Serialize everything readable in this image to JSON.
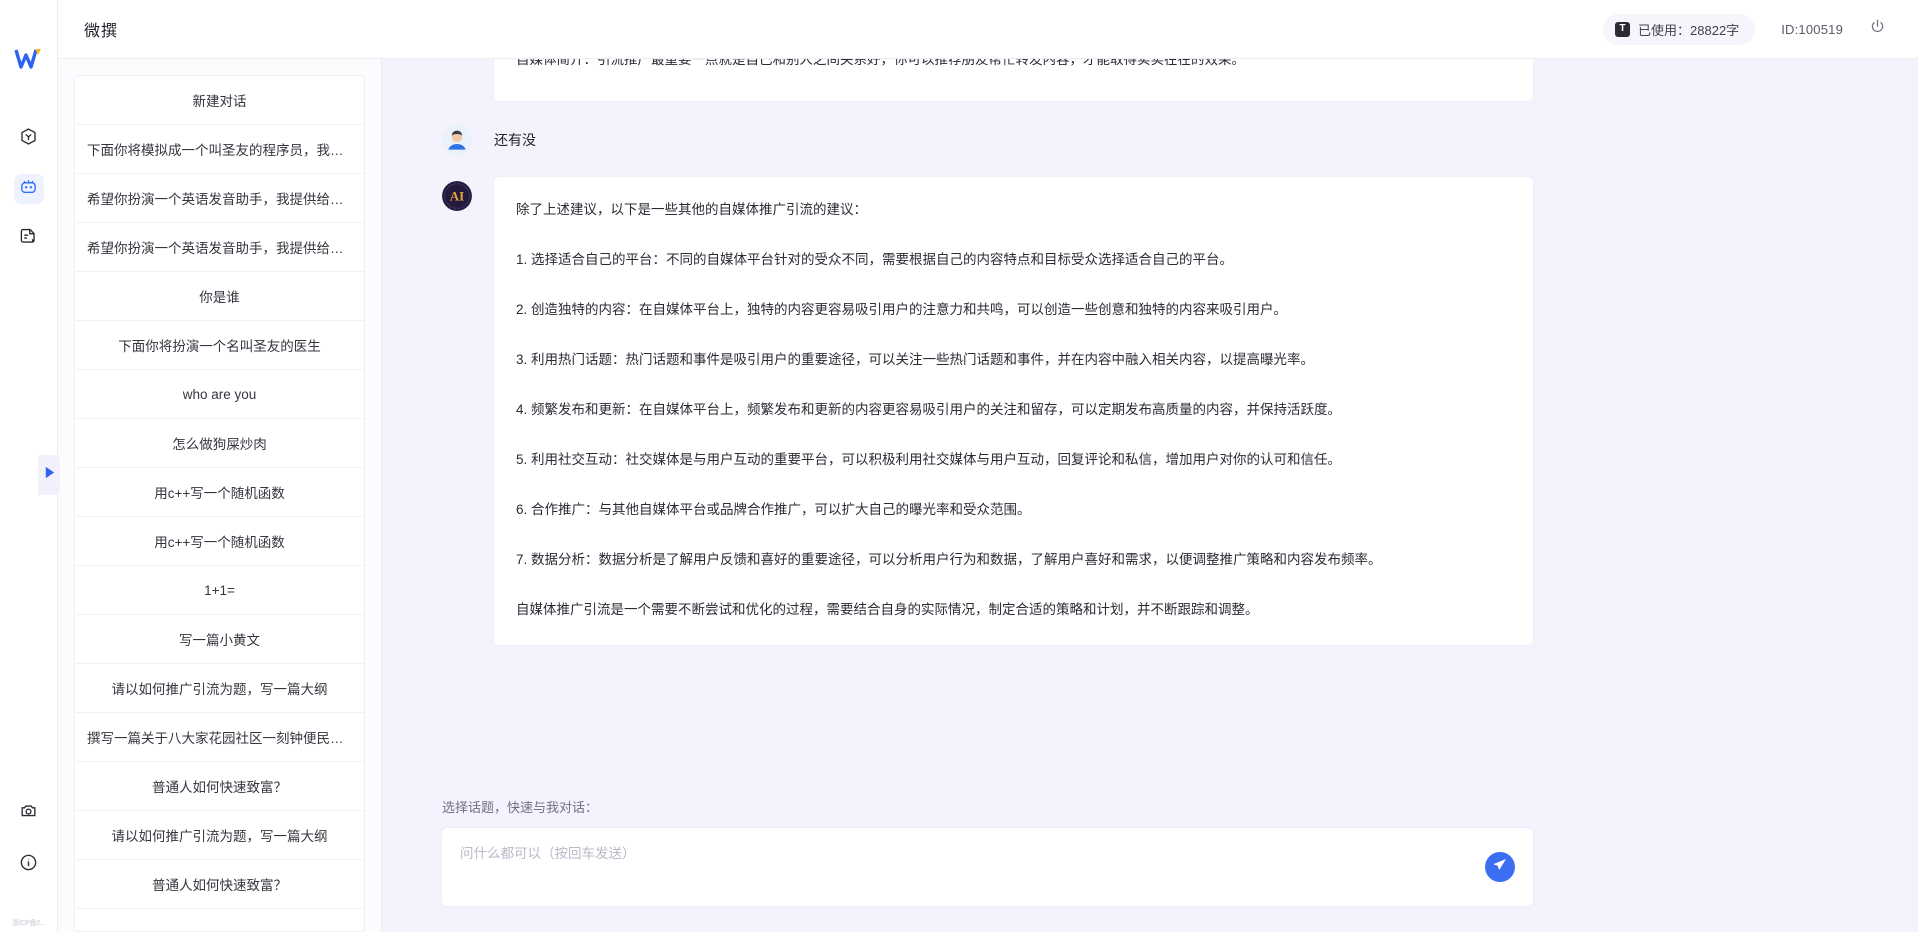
{
  "app": {
    "title": "微撰",
    "logo_icon": "w-logo-icon"
  },
  "topbar": {
    "usage_label": "已使用：28822字",
    "usage_icon": "text-count-icon",
    "user_id": "ID:100519",
    "power_icon": "power-icon"
  },
  "rail": {
    "items": [
      {
        "icon": "cube-icon",
        "active": false
      },
      {
        "icon": "robot-icon",
        "active": true
      },
      {
        "icon": "document-edit-icon",
        "active": false
      }
    ],
    "bottom_items": [
      {
        "icon": "settings-camera-icon"
      },
      {
        "icon": "info-icon"
      }
    ],
    "collapse_icon": "play-arrow-icon",
    "footer_text": "浙ICP备2..."
  },
  "sidebar": {
    "items": [
      {
        "label": "新建对话"
      },
      {
        "label": "下面你将模拟成一个叫圣友的程序员，我说..."
      },
      {
        "label": "希望你扮演一个英语发音助手，我提供给你..."
      },
      {
        "label": "希望你扮演一个英语发音助手，我提供给你..."
      },
      {
        "label": "你是谁"
      },
      {
        "label": "下面你将扮演一个名叫圣友的医生"
      },
      {
        "label": "who are you"
      },
      {
        "label": "怎么做狗屎炒肉"
      },
      {
        "label": "用c++写一个随机函数"
      },
      {
        "label": "用c++写一个随机函数"
      },
      {
        "label": "1+1="
      },
      {
        "label": "写一篇小黄文"
      },
      {
        "label": "请以如何推广引流为题，写一篇大纲"
      },
      {
        "label": "撰写一篇关于八大家花园社区一刻钟便民生..."
      },
      {
        "label": "普通人如何快速致富？"
      },
      {
        "label": "请以如何推广引流为题，写一篇大纲"
      },
      {
        "label": "普通人如何快速致富？"
      }
    ]
  },
  "chat": {
    "clipped_message": "自媒体简介：引流推广最重要一点就是自己和别人之间关系好，你可以推荐朋友帮忙转发内容，才能取得实实在在的效果。",
    "user_message": {
      "avatar_icon": "user-avatar-icon",
      "text": "还有没"
    },
    "ai_message": {
      "avatar_icon": "ai-avatar-icon",
      "paragraphs": [
        "除了上述建议，以下是一些其他的自媒体推广引流的建议：",
        "1. 选择适合自己的平台：不同的自媒体平台针对的受众不同，需要根据自己的内容特点和目标受众选择适合自己的平台。",
        "2. 创造独特的内容：在自媒体平台上，独特的内容更容易吸引用户的注意力和共鸣，可以创造一些创意和独特的内容来吸引用户。",
        "3. 利用热门话题：热门话题和事件是吸引用户的重要途径，可以关注一些热门话题和事件，并在内容中融入相关内容，以提高曝光率。",
        "4. 频繁发布和更新：在自媒体平台上，频繁发布和更新的内容更容易吸引用户的关注和留存，可以定期发布高质量的内容，并保持活跃度。",
        "5. 利用社交互动：社交媒体是与用户互动的重要平台，可以积极利用社交媒体与用户互动，回复评论和私信，增加用户对你的认可和信任。",
        "6. 合作推广：与其他自媒体平台或品牌合作推广，可以扩大自己的曝光率和受众范围。",
        "7. 数据分析：数据分析是了解用户反馈和喜好的重要途径，可以分析用户行为和数据，了解用户喜好和需求，以便调整推广策略和内容发布频率。",
        "自媒体推广引流是一个需要不断尝试和优化的过程，需要结合自身的实际情况，制定合适的策略和计划，并不断跟踪和调整。"
      ]
    }
  },
  "composer": {
    "label": "选择话题，快速与我对话：",
    "placeholder": "问什么都可以（按回车发送）",
    "send_icon": "send-icon"
  },
  "colors": {
    "accent": "#3b6ef0",
    "chat_bg": "#f4f3fd",
    "bubble": "#ffffff"
  }
}
